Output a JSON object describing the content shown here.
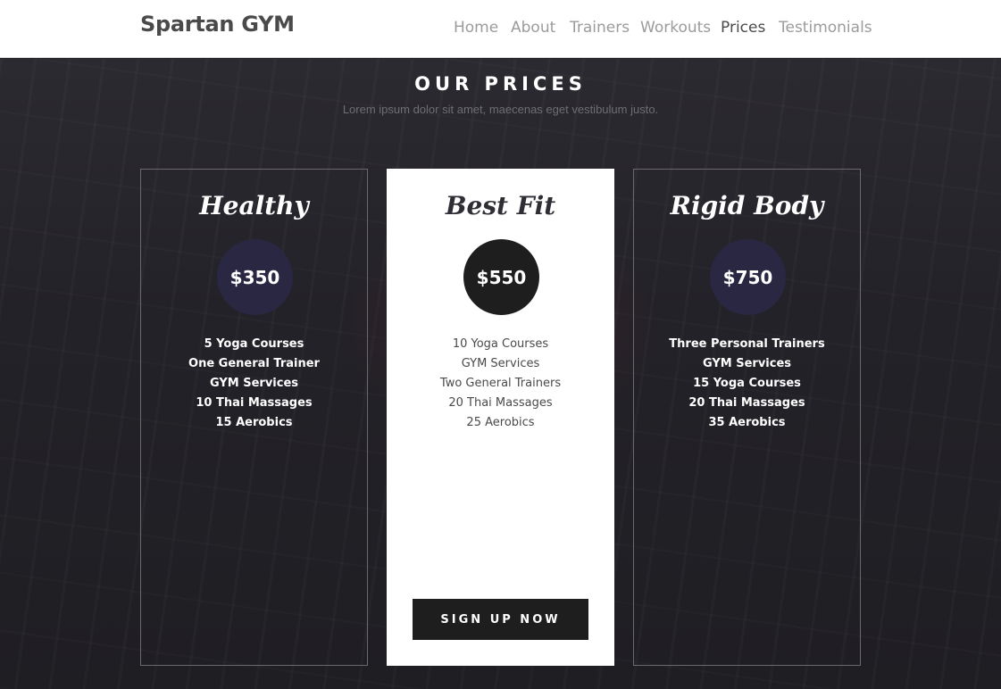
{
  "brand": "Spartan GYM",
  "nav": [
    "Home",
    "About",
    "Trainers",
    "Workouts",
    "Prices",
    "Testimonials"
  ],
  "active_nav": "Prices",
  "section": {
    "title": "OUR PRICES",
    "subtitle": "Lorem ipsum dolor sit amet, maecenas eget vestibulum justo."
  },
  "plans": [
    {
      "name": "Healthy",
      "price": "$350",
      "features": [
        "5 Yoga Courses",
        "One General Trainer",
        "GYM Services",
        "10 Thai Massages",
        "15 Aerobics"
      ]
    },
    {
      "name": "Best Fit",
      "price": "$550",
      "features": [
        "10 Yoga Courses",
        "GYM Services",
        "Two General Trainers",
        "20 Thai Massages",
        "25 Aerobics"
      ],
      "button": "SIGN UP NOW"
    },
    {
      "name": "Rigid Body",
      "price": "$750",
      "features": [
        "Three Personal Trainers",
        "GYM Services",
        "15 Yoga Courses",
        "20 Thai Massages",
        "35 Aerobics"
      ]
    }
  ],
  "colors": {
    "header_bg": "#ffffff",
    "page_bg": "#1c1b20",
    "price_circle_dark": "#2a2742",
    "price_circle_featured": "#1e1e1e",
    "button_bg": "#1e1e1e"
  }
}
